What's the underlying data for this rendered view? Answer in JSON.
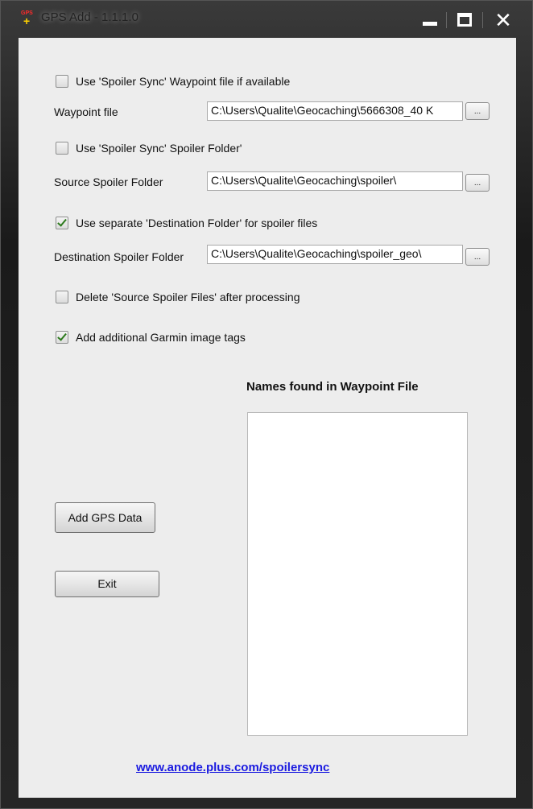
{
  "window": {
    "title": "GPS Add - 1.1.1.0",
    "icon_label": "GPS",
    "controls": {
      "minimize": "",
      "maximize": "",
      "close": "✕"
    }
  },
  "options": {
    "use_waypoint_file": {
      "label": "Use 'Spoiler Sync' Waypoint file if available",
      "checked": false
    },
    "waypoint_file": {
      "label": "Waypoint file",
      "value": "C:\\Users\\Qualite\\Geocaching\\5666308_40 K"
    },
    "use_spoiler_folder": {
      "label": "Use 'Spoiler Sync' Spoiler Folder'",
      "checked": false
    },
    "source_folder": {
      "label": "Source Spoiler Folder",
      "value": "C:\\Users\\Qualite\\Geocaching\\spoiler\\"
    },
    "use_destination": {
      "label": "Use separate 'Destination Folder' for spoiler files",
      "checked": true
    },
    "destination_folder": {
      "label": "Destination Spoiler Folder",
      "value": "C:\\Users\\Qualite\\Geocaching\\spoiler_geo\\"
    },
    "delete_source": {
      "label": "Delete 'Source Spoiler Files' after processing",
      "checked": false
    },
    "garmin_tags": {
      "label": "Add additional Garmin image tags",
      "checked": true
    }
  },
  "browse_label": "...",
  "buttons": {
    "add_gps": "Add GPS Data",
    "exit": "Exit"
  },
  "names_list": {
    "heading": "Names found in Waypoint File",
    "items": []
  },
  "footer_link": "www.anode.plus.com/spoilersync"
}
